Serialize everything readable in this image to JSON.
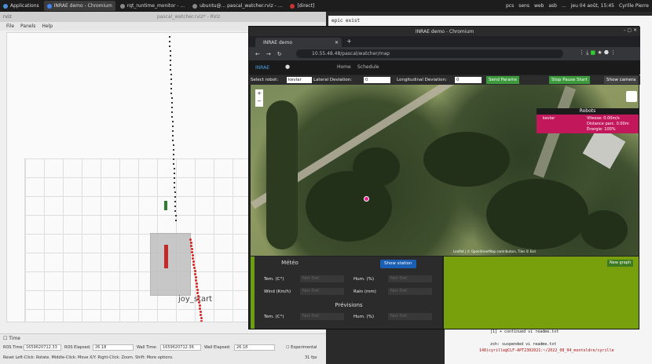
{
  "taskbar": {
    "tasks": [
      "Applications",
      "INRAE demo - Chromium",
      "rqt_runtime_monitor - ...",
      "ubuntu@... pascal_watcher.rviz - ...",
      "[direct]"
    ],
    "tray": [
      "pcs",
      "sens",
      "web",
      "asb",
      "..."
    ],
    "clock": "jeu 04 août, 15:45",
    "user": "Cyrille Pierre"
  },
  "rviz": {
    "title": "rviz",
    "center_title": "pascal_watcher.rviz* - RViz",
    "menu": [
      "File",
      "Panels",
      "Help"
    ],
    "joy_label": "joy_start",
    "time": {
      "panel_title": "Time",
      "ros_time_label": "ROS Time:",
      "ros_time": "1659620712.33",
      "ros_elapsed_label": "ROS Elapsed:",
      "ros_elapsed": "26.18",
      "wall_time_label": "Wall Time:",
      "wall_time": "1659620712.36",
      "wall_elapsed_label": "Wall Elapsed:",
      "wall_elapsed": "26.18",
      "experimental": "Experimental",
      "hint": "Reset  Left-Click: Rotate.  Middle-Click: Move X/Y.  Right-Click: Zoom.  Shift: More options.",
      "fps": "31 fps"
    }
  },
  "terminal": {
    "top_line": "epic exist",
    "lines": [
      "[1]  + continued  vi readme.txt",
      "",
      "zsh: suspended  vi readme.txt",
      "148)cyrille@CLF-APT2302021:~/2022_08_04_montoldre/cyrille"
    ]
  },
  "chrome": {
    "window_title": "INRAE demo - Chromium",
    "tab_title": "INRAE demo",
    "url": "10.55.48.48/pascal/watcher/map",
    "app": {
      "brand": "INRAE",
      "nav": [
        "Home",
        "Schedule"
      ],
      "controls": {
        "select_robot_label": "Select robot:",
        "select_robot_value": "kevlar",
        "lateral_label": "Lateral Deviation:",
        "lateral_value": "0",
        "longitudinal_label": "Longitudinal Deviation:",
        "longitudinal_value": "0",
        "send_params": "Send Params",
        "stop_pause_start": "Stop  Pause  Start",
        "show_camera": "Show camera"
      },
      "map": {
        "zoom_in": "+",
        "zoom_out": "−",
        "robots_panel": {
          "title": "Robots",
          "robot_name": "kevlar",
          "rows": [
            "Vitesse: 0.00m/s",
            "Distance parc. 0.00m",
            "Énergie: 100%"
          ]
        },
        "attribution": "Leaflet | © OpenStreetMap contributors, Tiles © Esri"
      },
      "meteo": {
        "title": "Météo",
        "show_station": "Show station",
        "temp_label": "Tem. (C°)",
        "temp_value": "Not Def.",
        "hum_label": "Hum. (%)",
        "hum_value": "Not Def.",
        "wind_label": "Wind (Km/h)",
        "wind_value": "Not Def.",
        "rain_label": "Rain (mm)",
        "rain_value": "Not Def.",
        "previsions_title": "Prévisions",
        "prev_temp_label": "Tem. (C°)",
        "prev_temp_value": "Not Def.",
        "prev_hum_label": "Hum. (%)",
        "prev_hum_value": "Not Def."
      },
      "new_graph": "New graph"
    }
  },
  "colors": {
    "brand": "#4aa3df",
    "robots_panel": "#c2185b",
    "marker": "#e91e90",
    "button_green": "#3c9a3c",
    "meteo_accent": "#6aa00f",
    "graph_panel": "#78a00c"
  }
}
